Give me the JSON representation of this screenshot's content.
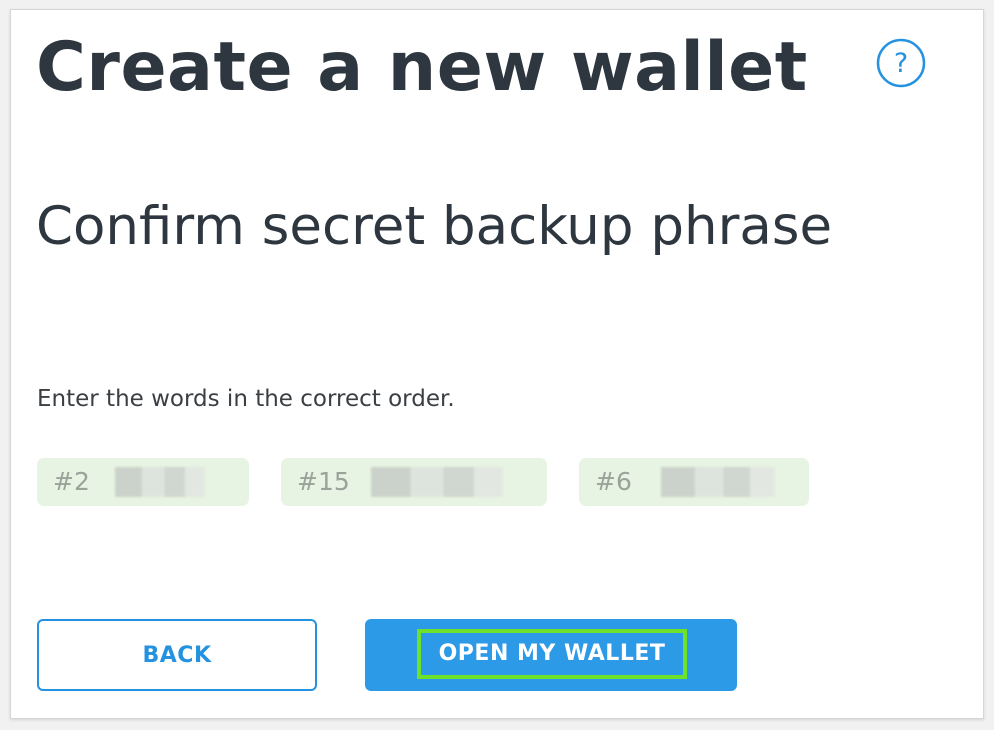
{
  "header": {
    "title": "Create a new wallet",
    "help_icon": "question-circle-icon",
    "help_label": "?"
  },
  "step": {
    "subtitle": "Confirm secret backup phrase",
    "instruction": "Enter the words in the correct order."
  },
  "word_fields": [
    {
      "label": "#2",
      "value": ""
    },
    {
      "label": "#15",
      "value": ""
    },
    {
      "label": "#6",
      "value": ""
    }
  ],
  "actions": {
    "back_label": "BACK",
    "open_label": "OPEN MY WALLET"
  },
  "colors": {
    "accent": "#2d9ae8",
    "heading": "#2e373f",
    "field_bg": "#e8f4e3",
    "highlight": "#6ee12a"
  }
}
